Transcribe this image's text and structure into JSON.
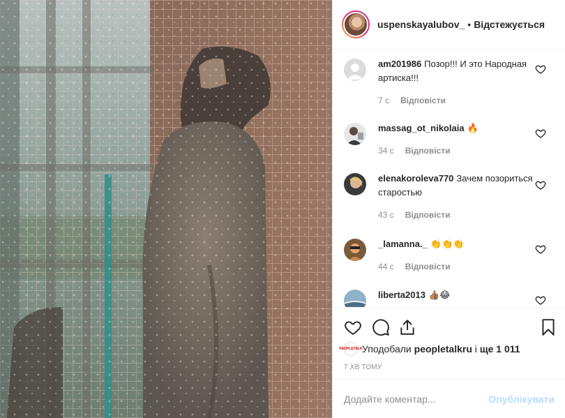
{
  "header": {
    "username": "uspenskayalubov_",
    "separator": "•",
    "following_label": "Відстежується"
  },
  "comments": [
    {
      "username": "am201986",
      "text": "Позор!!! И это Народная артиска!!!",
      "age": "7 с",
      "reply_label": "Відповісти",
      "avatar_icon": "default-avatar-icon"
    },
    {
      "username": "massag_ot_nikolaia",
      "text": "🔥",
      "age": "34 с",
      "reply_label": "Відповісти",
      "avatar_icon": "user-avatar"
    },
    {
      "username": "elenakoroleva770",
      "text": "Зачем позориться старостью",
      "age": "43 с",
      "reply_label": "Відповісти",
      "avatar_icon": "user-avatar"
    },
    {
      "username": "_lamanna._",
      "text": "👏👏👏",
      "age": "44 с",
      "reply_label": "Відповісти",
      "avatar_icon": "user-avatar"
    },
    {
      "username": "liberta2013",
      "text": "👍🏽😂",
      "age": "",
      "reply_label": "",
      "avatar_icon": "user-avatar"
    }
  ],
  "actions": {
    "like_icon": "heart-icon",
    "comment_icon": "comment-icon",
    "share_icon": "share-icon",
    "save_icon": "bookmark-icon"
  },
  "likes": {
    "prefix": "Уподобали",
    "liker": "peopletalkru",
    "conj": "і",
    "others": "ще 1 011",
    "liker_avatar_text": "PEOPLETALK"
  },
  "timestamp": "7 ХВ ТОМУ",
  "add_comment": {
    "placeholder": "Додайте коментар...",
    "post_label": "Опублікувати"
  },
  "colors": {
    "text": "#262626",
    "muted": "#8e8e8e",
    "border": "#efefef",
    "post_disabled": "#b2dffc"
  }
}
